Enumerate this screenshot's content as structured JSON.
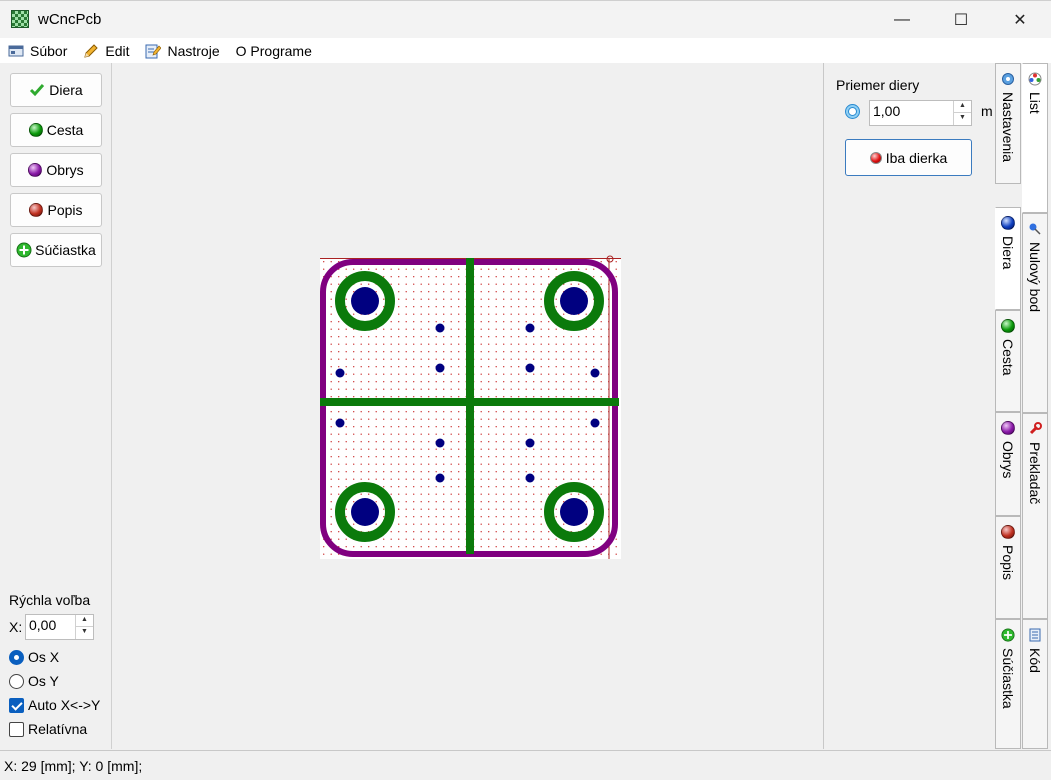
{
  "window": {
    "title": "wCncPcb",
    "minimize": "—",
    "maximize": "☐",
    "close": "✕"
  },
  "menu": {
    "items": [
      {
        "label": "Súbor",
        "icon": "file-menu-icon"
      },
      {
        "label": "Edit",
        "icon": "pencil-icon"
      },
      {
        "label": "Nastroje",
        "icon": "notepad-pencil-icon"
      },
      {
        "label": "O Programe",
        "icon": ""
      }
    ]
  },
  "tools": {
    "diera": "Diera",
    "cesta": "Cesta",
    "obrys": "Obrys",
    "popis": "Popis",
    "suciastka": "Súčiastka"
  },
  "quick": {
    "title": "Rýchla voľba",
    "x_label": "X:",
    "x_value": "0,00",
    "os_x": "Os X",
    "os_y": "Os Y",
    "auto_xy": "Auto X<->Y",
    "relativna": "Relatívna",
    "os_x_selected": true,
    "auto_checked": true,
    "relativna_checked": false
  },
  "props": {
    "label": "Priemer diery",
    "value": "1,00",
    "unit": "m",
    "button": "Iba dierka"
  },
  "tabs_inner": {
    "nastavenia": "Nastavenia",
    "diera": "Diera",
    "cesta": "Cesta",
    "obrys": "Obrys",
    "popis": "Popis",
    "suciastka": "Súčiastka"
  },
  "tabs_outer": {
    "list": "List",
    "nulovy_bod": "Nulový bod",
    "prekladac": "Prekladač",
    "kod": "Kód"
  },
  "status": {
    "text": "X: 29 [mm];  Y: 0 [mm];"
  },
  "colors": {
    "pad_ring": "#0b7a0b",
    "pad_hole": "#000080",
    "trace": "#0b7a0b",
    "outline": "#800080",
    "via": "#000080",
    "grid_dot": "#cc3333"
  }
}
